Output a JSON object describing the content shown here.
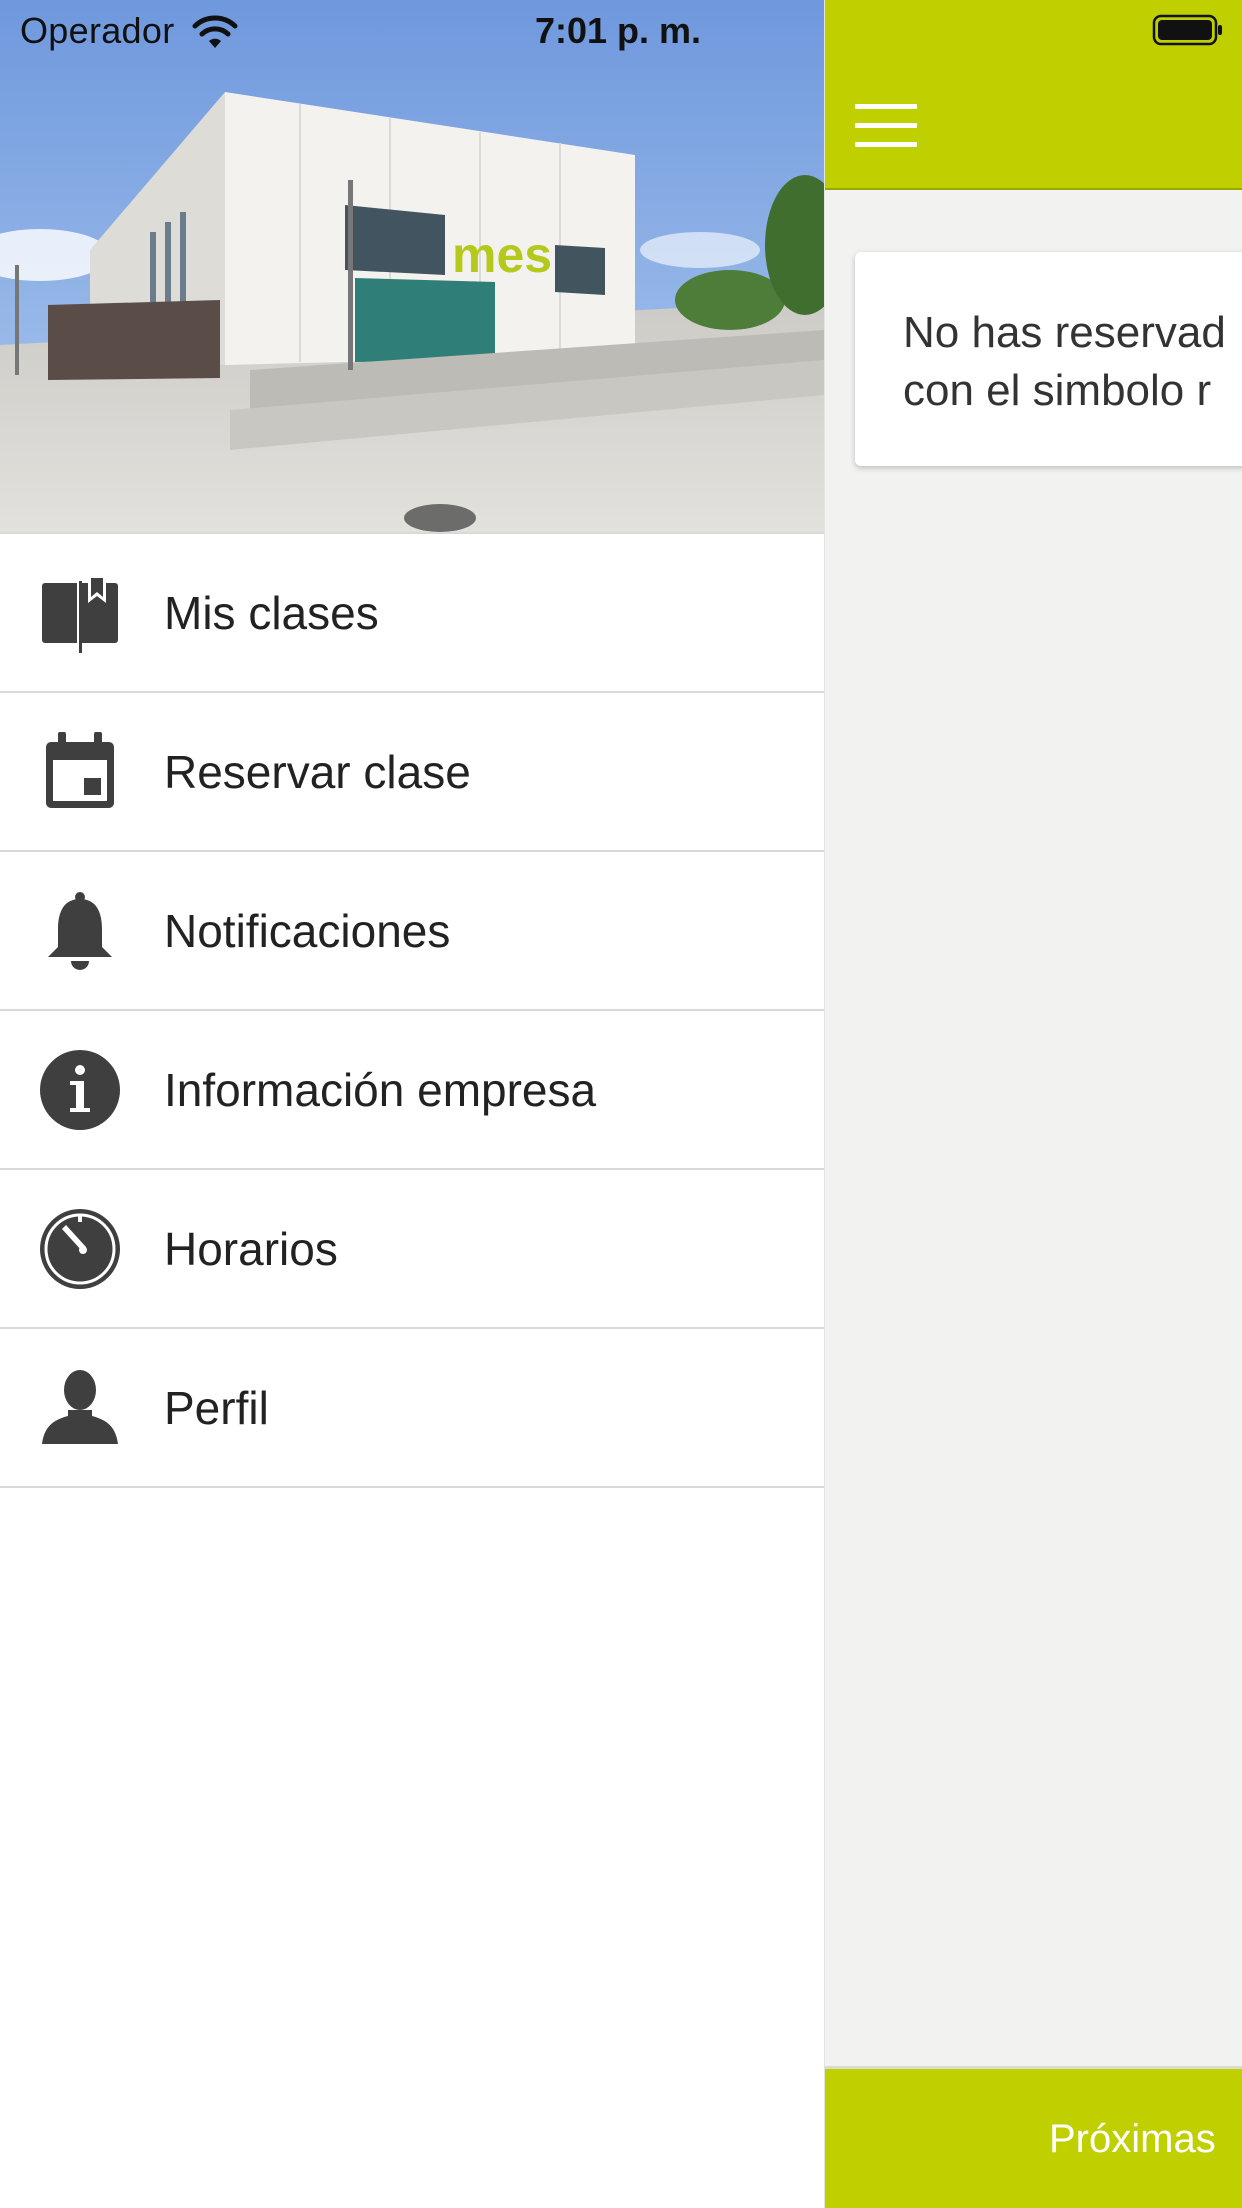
{
  "status_bar": {
    "carrier": "Operador",
    "time": "7:01 p. m."
  },
  "drawer": {
    "menu": [
      {
        "label": "Mis clases",
        "icon": "bookmark-book-icon"
      },
      {
        "label": "Reservar clase",
        "icon": "calendar-icon"
      },
      {
        "label": "Notificaciones",
        "icon": "bell-icon"
      },
      {
        "label": "Información empresa",
        "icon": "info-icon"
      },
      {
        "label": "Horarios",
        "icon": "clock-icon"
      },
      {
        "label": "Perfil",
        "icon": "person-icon"
      }
    ]
  },
  "main": {
    "empty_message": "No has reservad\ncon el simbolo r",
    "bottom_tab_label": "Próximas"
  },
  "colors": {
    "accent": "#c0cf00",
    "icon": "#3f3f3f",
    "background": "#f2f2f0"
  },
  "hero": {
    "building_sign": "mes"
  }
}
